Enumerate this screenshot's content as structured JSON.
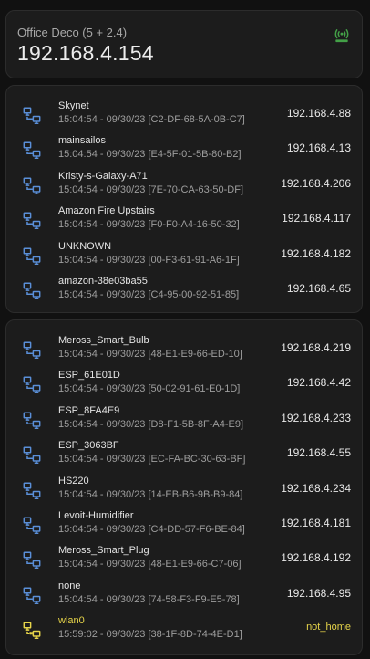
{
  "header": {
    "title": "Office Deco (5 + 2.4)",
    "ip": "192.168.4.154",
    "icon": "wifi-access-point-icon",
    "icon_color": "#43a047"
  },
  "colors": {
    "device_icon": "#5a8fd8",
    "away_icon": "#e6d44a",
    "away_text": "#e6d44a"
  },
  "group1": [
    {
      "name": "Skynet",
      "sub": "15:04:54 - 09/30/23 [C2-DF-68-5A-0B-C7]",
      "ip": "192.168.4.88"
    },
    {
      "name": "mainsailos",
      "sub": "15:04:54 - 09/30/23 [E4-5F-01-5B-80-B2]",
      "ip": "192.168.4.13"
    },
    {
      "name": "Kristy-s-Galaxy-A71",
      "sub": "15:04:54 - 09/30/23 [7E-70-CA-63-50-DF]",
      "ip": "192.168.4.206"
    },
    {
      "name": "Amazon Fire Upstairs",
      "sub": "15:04:54 - 09/30/23 [F0-F0-A4-16-50-32]",
      "ip": "192.168.4.117"
    },
    {
      "name": "UNKNOWN",
      "sub": "15:04:54 - 09/30/23 [00-F3-61-91-A6-1F]",
      "ip": "192.168.4.182"
    },
    {
      "name": "amazon-38e03ba55",
      "sub": "15:04:54 - 09/30/23 [C4-95-00-92-51-85]",
      "ip": "192.168.4.65"
    }
  ],
  "group2": [
    {
      "name": "Meross_Smart_Bulb",
      "sub": "15:04:54 - 09/30/23 [48-E1-E9-66-ED-10]",
      "ip": "192.168.4.219"
    },
    {
      "name": "ESP_61E01D",
      "sub": "15:04:54 - 09/30/23 [50-02-91-61-E0-1D]",
      "ip": "192.168.4.42"
    },
    {
      "name": "ESP_8FA4E9",
      "sub": "15:04:54 - 09/30/23 [D8-F1-5B-8F-A4-E9]",
      "ip": "192.168.4.233"
    },
    {
      "name": "ESP_3063BF",
      "sub": "15:04:54 - 09/30/23 [EC-FA-BC-30-63-BF]",
      "ip": "192.168.4.55"
    },
    {
      "name": "HS220",
      "sub": "15:04:54 - 09/30/23 [14-EB-B6-9B-B9-84]",
      "ip": "192.168.4.234"
    },
    {
      "name": "Levoit-Humidifier",
      "sub": "15:04:54 - 09/30/23 [C4-DD-57-F6-BE-84]",
      "ip": "192.168.4.181"
    },
    {
      "name": "Meross_Smart_Plug",
      "sub": "15:04:54 - 09/30/23 [48-E1-E9-66-C7-06]",
      "ip": "192.168.4.192"
    },
    {
      "name": "none",
      "sub": "15:04:54 - 09/30/23 [74-58-F3-F9-E5-78]",
      "ip": "192.168.4.95"
    },
    {
      "name": "wlan0",
      "sub": "15:59:02 - 09/30/23 [38-1F-8D-74-4E-D1]",
      "ip": "not_home",
      "away": true
    }
  ]
}
